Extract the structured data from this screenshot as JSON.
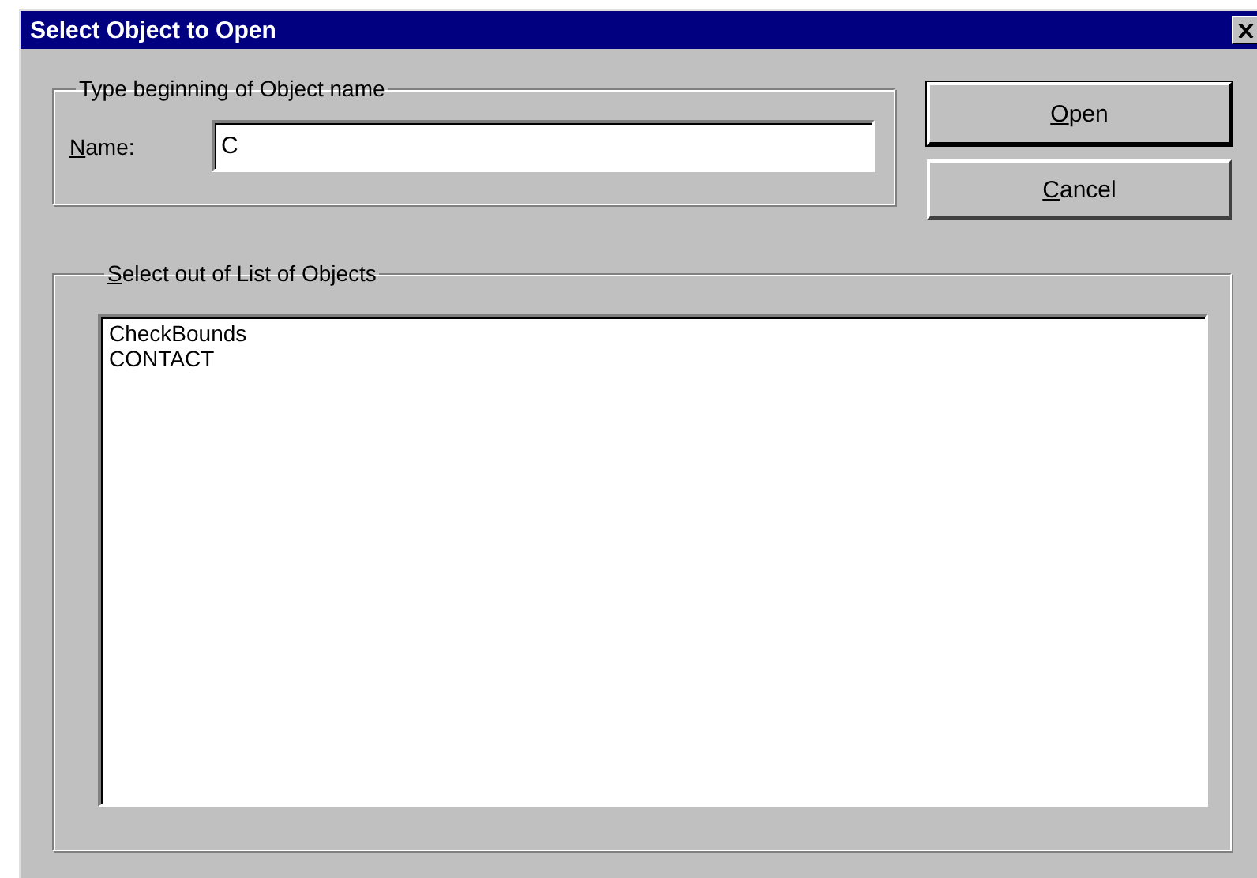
{
  "window": {
    "title": "Select Object to Open"
  },
  "name_group": {
    "title": "Type beginning of Object name",
    "label": "Name:",
    "label_underline_first": true,
    "value": "C"
  },
  "buttons": [
    {
      "label": "Open",
      "default": true,
      "underline_first": true
    },
    {
      "label": "Cancel",
      "default": false,
      "underline_first": true
    }
  ],
  "list_group": {
    "title": "Select out of List of Objects",
    "title_underline_first": true,
    "items": [
      {
        "label": "CheckBounds",
        "selected": false
      },
      {
        "label": "CONTACT",
        "selected": false
      }
    ]
  }
}
